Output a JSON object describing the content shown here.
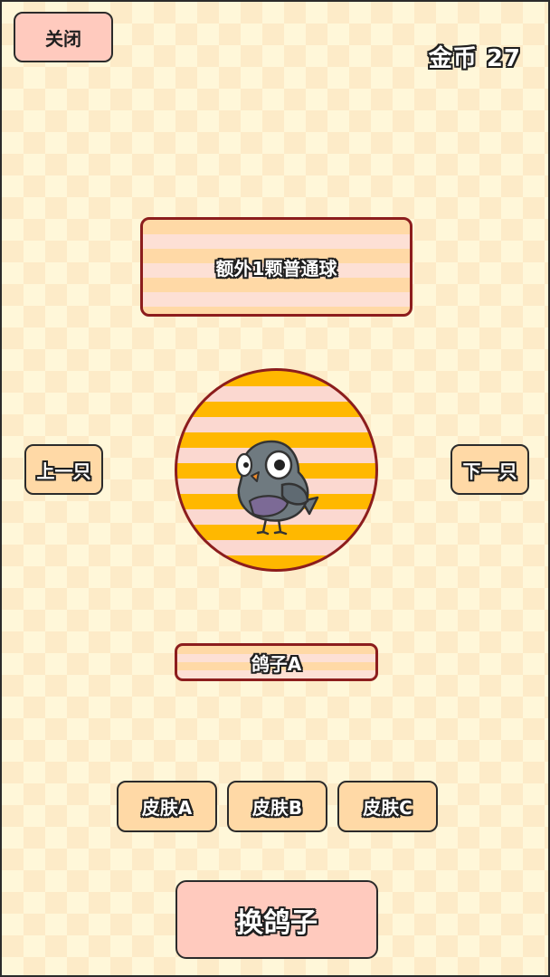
{
  "header": {
    "close_label": "关闭",
    "coins_label": "金币",
    "coins_value": "27"
  },
  "perk": {
    "text": "额外1颗普通球"
  },
  "navigation": {
    "prev_label": "上一只",
    "next_label": "下一只"
  },
  "pigeon": {
    "name": "鸽子A",
    "icon": "pigeon-icon"
  },
  "skins": [
    {
      "label": "皮肤A"
    },
    {
      "label": "皮肤B"
    },
    {
      "label": "皮肤C"
    }
  ],
  "actions": {
    "change_label": "换鸽子"
  },
  "colors": {
    "background": "#fff7d9",
    "button_pink": "#ffcabe",
    "button_peach": "#ffd9a6",
    "stripe_orange": "#ffb800",
    "border_red": "#8c1d1d"
  }
}
